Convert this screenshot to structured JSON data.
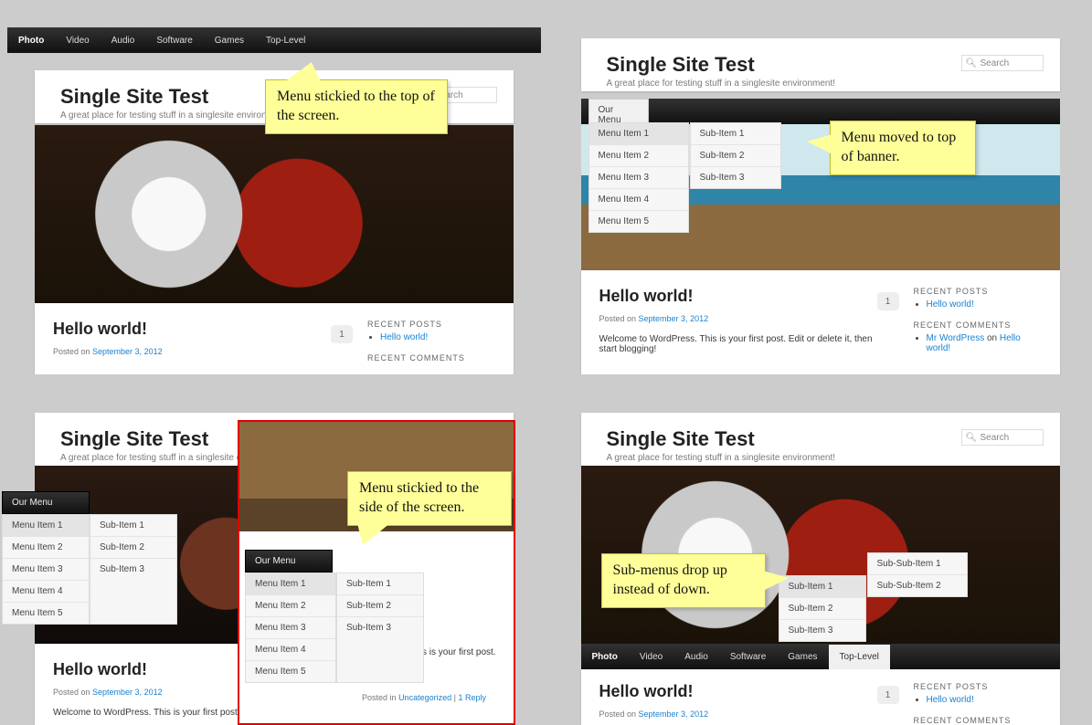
{
  "common": {
    "site_title": "Single Site Test",
    "tagline": "A great place for testing stuff in a singlesite environment!",
    "search_placeholder": "Search",
    "post_title": "Hello world!",
    "posted_on": "Posted on ",
    "post_date": "September 3, 2012",
    "post_body": "Welcome to WordPress. This is your first post. Edit or delete it, then start blogging!",
    "post_body_trunc": "Welcome to WordPress. This is your first post. Edi",
    "post_body_mid": "e to WordPress. This is your first post. Edit or delete it,",
    "posted_in": "Posted in ",
    "uncategorized": "Uncategorized",
    "reply_sep": " | ",
    "reply": "1 Reply",
    "comment_count": "1",
    "recent_posts_h": "Recent Posts",
    "recent_posts_link": "Hello world!",
    "recent_comments_h": "Recent Comments",
    "rc_author": "Mr WordPress",
    "rc_on": " on ",
    "rc_post": "Hello world!"
  },
  "hmenu": {
    "items": [
      "Photo",
      "Video",
      "Audio",
      "Software",
      "Games",
      "Top-Level"
    ]
  },
  "ourmenu": {
    "header": "Our Menu",
    "items": [
      "Menu Item 1",
      "Menu Item 2",
      "Menu Item 3",
      "Menu Item 4",
      "Menu Item 5"
    ],
    "subs": [
      "Sub-Item 1",
      "Sub-Item 2",
      "Sub-Item 3"
    ],
    "subsubs": [
      "Sub-Sub-Item 1",
      "Sub-Sub-Item 2"
    ]
  },
  "callouts": {
    "a": "Menu stickied to the top of the screen.",
    "b": "Menu moved to top of banner.",
    "c": "Menu stickied to the side of the screen.",
    "d": "Sub-menus drop up instead of down."
  }
}
